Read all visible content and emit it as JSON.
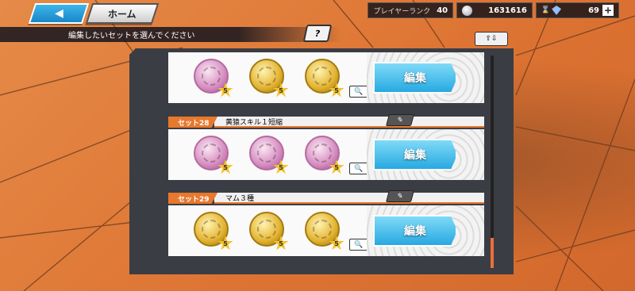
{
  "topbar": {
    "back_icon": "left-arrow-icon",
    "home_label": "ホーム",
    "player_rank_label": "プレイヤーランク",
    "player_rank_value": "40",
    "coins_value": "1631616",
    "gems_value": "69",
    "plus_label": "+"
  },
  "instruction": "編集したいセットを選んでください",
  "help_label": "?",
  "sort_label": "⇧⇩",
  "sets": [
    {
      "tag": "",
      "name": "",
      "edit_label": "編集",
      "zoom_label": "🔍",
      "medals": [
        {
          "color": "pink",
          "stars": "5"
        },
        {
          "color": "gold",
          "stars": "5"
        },
        {
          "color": "gold",
          "stars": "5"
        }
      ]
    },
    {
      "tag": "セット28",
      "name": "黄猿スキル１短縮",
      "edit_label": "編集",
      "zoom_label": "🔍",
      "medals": [
        {
          "color": "pink",
          "stars": "5"
        },
        {
          "color": "pink",
          "stars": "5"
        },
        {
          "color": "pink",
          "stars": "5"
        }
      ]
    },
    {
      "tag": "セット29",
      "name": "マム３種",
      "edit_label": "編集",
      "zoom_label": "🔍",
      "medals": [
        {
          "color": "gold",
          "stars": "5"
        },
        {
          "color": "gold",
          "stars": "5"
        },
        {
          "color": "gold",
          "stars": "5"
        }
      ]
    }
  ]
}
